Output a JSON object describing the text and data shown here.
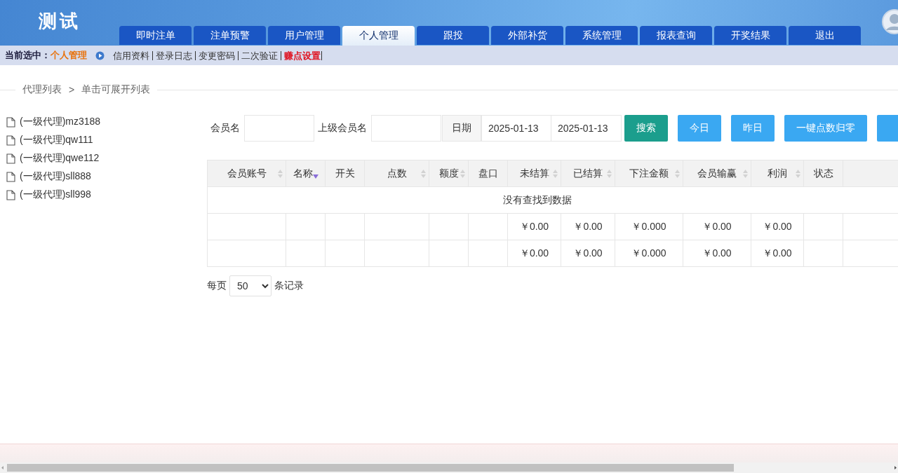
{
  "header": {
    "title": "测试"
  },
  "nav_tabs": [
    {
      "label": "即时注单",
      "selected": false
    },
    {
      "label": "注单预警",
      "selected": false
    },
    {
      "label": "用户管理",
      "selected": false
    },
    {
      "label": "个人管理",
      "selected": true
    },
    {
      "label": "跟投",
      "selected": false
    },
    {
      "label": "外部补货",
      "selected": false
    },
    {
      "label": "系统管理",
      "selected": false
    },
    {
      "label": "报表查询",
      "selected": false
    },
    {
      "label": "开奖结果",
      "selected": false
    },
    {
      "label": "退出",
      "selected": false
    }
  ],
  "sub_nav": {
    "current_label": "当前选中：",
    "current_value": "个人管理",
    "links": [
      {
        "label": "信用资料",
        "highlighted": false
      },
      {
        "label": "登录日志",
        "highlighted": false
      },
      {
        "label": "变更密码",
        "highlighted": false
      },
      {
        "label": "二次验证",
        "highlighted": false
      },
      {
        "label": "赚点设置",
        "highlighted": true
      }
    ]
  },
  "breadcrumb": {
    "items": [
      "代理列表",
      "单击可展开列表"
    ],
    "separator": ">"
  },
  "agent_tree": [
    {
      "label": "(一级代理)mz3188"
    },
    {
      "label": "(一级代理)qw111"
    },
    {
      "label": "(一级代理)qwe112"
    },
    {
      "label": "(一级代理)sll888"
    },
    {
      "label": "(一级代理)sll998"
    }
  ],
  "filter": {
    "member_label": "会员名",
    "parent_label": "上级会员名",
    "date_label": "日期",
    "date_start": "2025-01-13",
    "date_end": "2025-01-13",
    "buttons": [
      {
        "label": "搜索",
        "kind": "primary"
      },
      {
        "label": "今日",
        "kind": "info"
      },
      {
        "label": "昨日",
        "kind": "info"
      },
      {
        "label": "一键点数归零",
        "kind": "info"
      },
      {
        "kind": "info"
      }
    ]
  },
  "table": {
    "columns": [
      {
        "label": "会员账号",
        "sortable": true,
        "sorted": false
      },
      {
        "label": "名称",
        "sorted": true
      },
      {
        "label": "开关",
        "sortable": false,
        "sorted": false
      },
      {
        "label": "点数",
        "sortable": true,
        "sorted": false
      },
      {
        "label": "额度",
        "sortable": true,
        "sorted": false
      },
      {
        "label": "盘口",
        "sortable": false,
        "sorted": false
      },
      {
        "label": "未结算",
        "sortable": true,
        "sorted": false
      },
      {
        "label": "已结算",
        "sortable": true,
        "sorted": false
      },
      {
        "label": "下注金额",
        "sortable": true,
        "sorted": false
      },
      {
        "label": "会员输赢",
        "sortable": true,
        "sorted": false
      },
      {
        "label": "利润",
        "sortable": true,
        "sorted": false
      },
      {
        "label": "状态",
        "sortable": false,
        "sorted": false
      }
    ],
    "empty_message": "没有查找到数据",
    "summary_rows": [
      [
        null,
        null,
        null,
        null,
        null,
        null,
        "￥0.00",
        "￥0.00",
        "￥0.000",
        "￥0.00",
        "￥0.00",
        null
      ],
      [
        null,
        null,
        null,
        null,
        null,
        null,
        "￥0.00",
        "￥0.00",
        "￥0.000",
        "￥0.00",
        "￥0.00",
        null
      ]
    ]
  },
  "pager": {
    "before": "每页",
    "page_size": "50",
    "after": "条记录"
  }
}
